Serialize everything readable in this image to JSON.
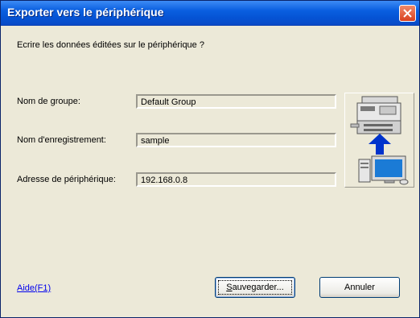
{
  "window": {
    "title": "Exporter vers le périphérique"
  },
  "dialog": {
    "prompt": "Ecrire les données éditées sur le périphérique ?",
    "fields": [
      {
        "label": "Nom de groupe:",
        "value": "Default Group"
      },
      {
        "label": "Nom d'enregistrement:",
        "value": "sample"
      },
      {
        "label": "Adresse de périphérique:",
        "value": "192.168.0.8"
      }
    ],
    "illustration_icons": [
      "printer-icon",
      "upload-arrow-icon",
      "computer-icon"
    ]
  },
  "footer": {
    "help_link": "Aide(F1)",
    "save_button": {
      "first_letter": "S",
      "rest": "auvegarder..."
    },
    "cancel_button": "Annuler"
  },
  "colors": {
    "titlebar": "#0553D4",
    "dialog_background": "#ECE9D8",
    "close_button": "#D9401E",
    "link": "#0000EE"
  }
}
